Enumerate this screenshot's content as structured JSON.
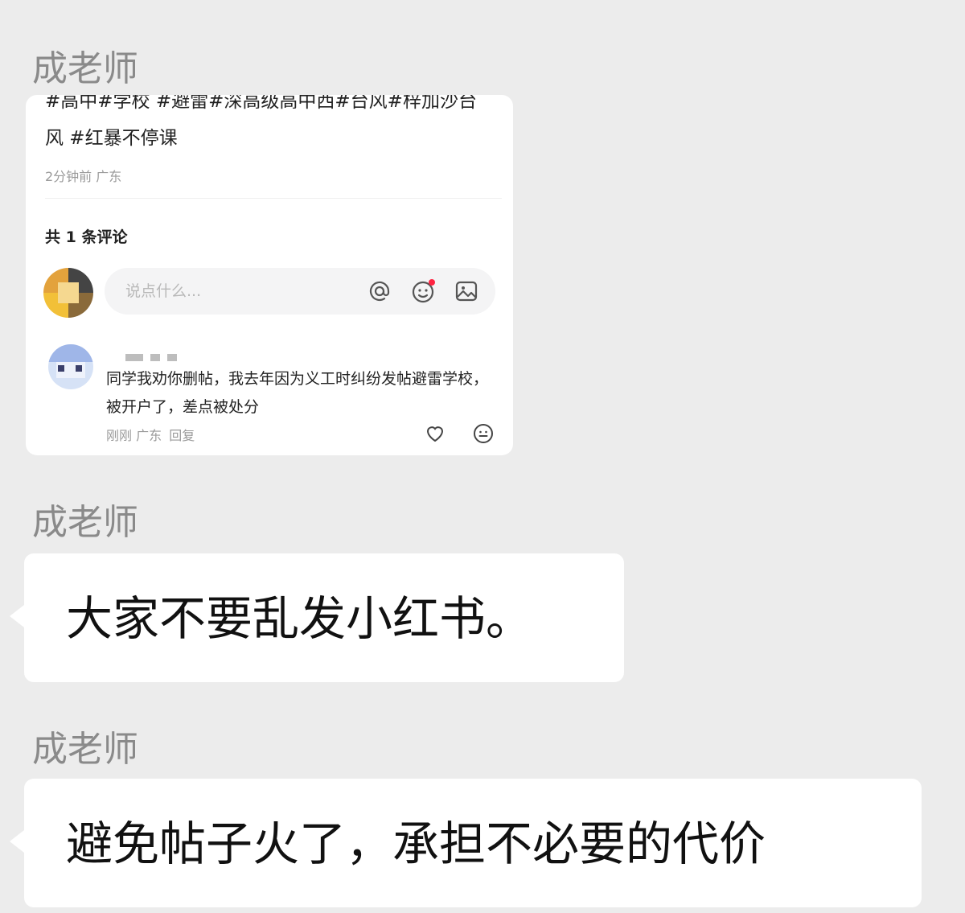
{
  "messages": [
    {
      "sender": "成老师"
    },
    {
      "sender": "成老师",
      "text": "大家不要乱发小红书。"
    },
    {
      "sender": "成老师",
      "text": "避免帖子火了，承担不必要的代价"
    }
  ],
  "shared_post": {
    "tags_cut_line": "#高中#学校 #避雷#深高级高中西#台风#梓加沙台",
    "tags_line2": "风  #红暴不停课",
    "posted_time": "2分钟前",
    "location": "广东",
    "comment_count": "共 1 条评论",
    "comment_placeholder": "说点什么...",
    "icons": {
      "mention": "at-icon",
      "emoji": "emoji-icon",
      "image": "image-icon",
      "like": "heart-icon",
      "react": "face-icon"
    },
    "comment": {
      "text": "同学我劝你删帖，我去年因为义工时纠纷发帖避雷学校，被开户了，差点被处分",
      "time": "刚刚",
      "location": "广东",
      "reply_label": "回复"
    },
    "colors": {
      "notification_dot": "#ff2442"
    }
  }
}
